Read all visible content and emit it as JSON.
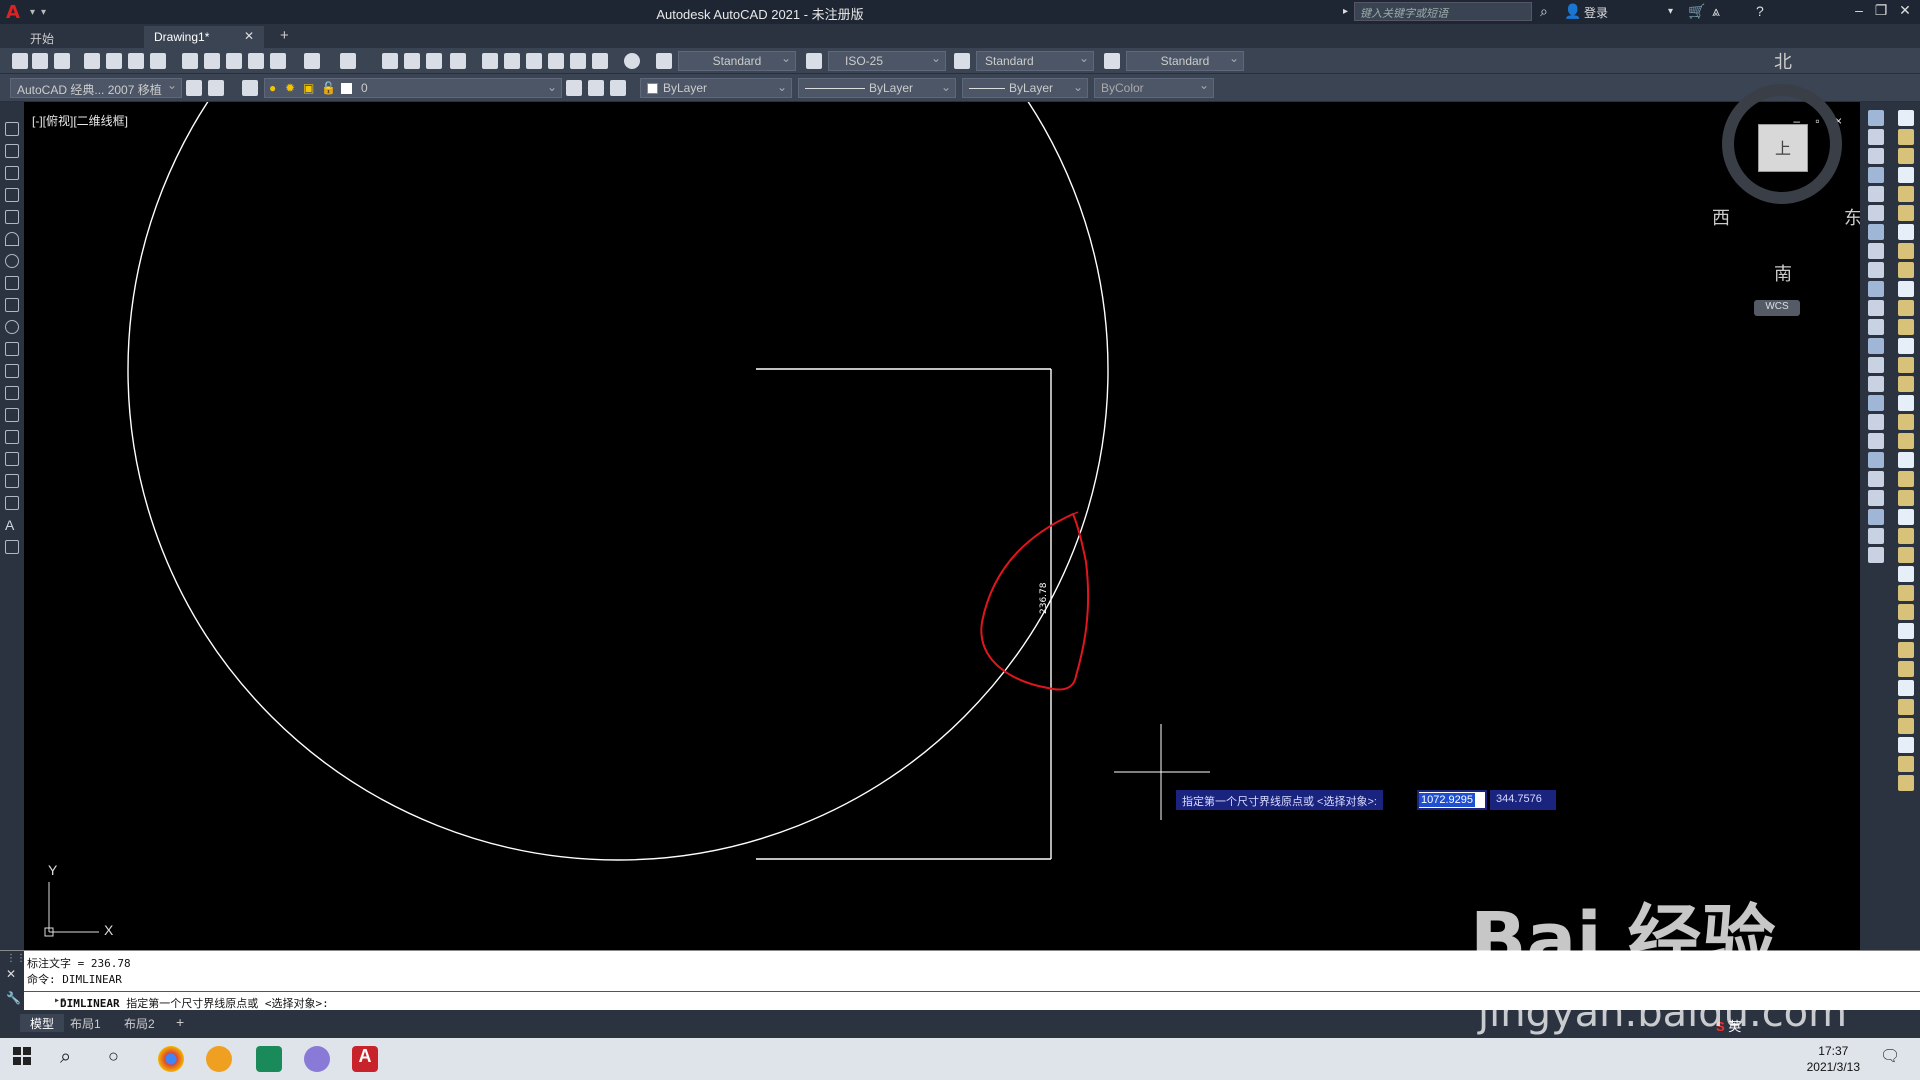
{
  "titlebar": {
    "title": "Autodesk AutoCAD 2021 - 未注册版",
    "search_placeholder": "键入关键字或短语",
    "login_label": "登录"
  },
  "tabs": [
    {
      "label": "开始"
    },
    {
      "label": "Drawing1*"
    }
  ],
  "toolbar1": {
    "text_style": "Standard",
    "dim_style": "ISO-25",
    "table_style": "Standard",
    "multileader_style": "Standard"
  },
  "toolbar2": {
    "workspace": "AutoCAD 经典... 2007 移植",
    "layer": "0",
    "color": "ByLayer",
    "linetype": "ByLayer",
    "lineweight": "ByLayer",
    "plotstyle": "ByColor"
  },
  "viewport": {
    "label": "[-][俯视][二维线框]",
    "controls": "– ▫ ×"
  },
  "viewcube": {
    "north": "北",
    "south": "南",
    "east": "东",
    "west": "西",
    "face": "上",
    "wcs": "WCS"
  },
  "ucs": {
    "x": "X",
    "y": "Y"
  },
  "drawing": {
    "dimension_text": "236.78",
    "colors": {
      "geometry": "#ffffff",
      "spline": "#e0161e"
    }
  },
  "dynamic_input": {
    "prompt": "指定第一个尺寸界线原点或 <选择对象>:",
    "x_value": "1072.9295",
    "y_value": "344.7576"
  },
  "command_line": {
    "history": [
      "标注文字 = 236.78",
      "命令:  DIMLINEAR"
    ],
    "current_command": "DIMLINEAR",
    "current_prompt": "指定第一个尺寸界线原点或 <选择对象>:"
  },
  "layout_tabs": [
    {
      "label": "模型"
    },
    {
      "label": "布局1"
    },
    {
      "label": "布局2"
    }
  ],
  "taskbar": {
    "time": "17:37",
    "date": "2021/3/13",
    "ime_label": "英"
  },
  "watermark": {
    "text": "Bai  经验",
    "url": "jingyan.baidu.com"
  }
}
